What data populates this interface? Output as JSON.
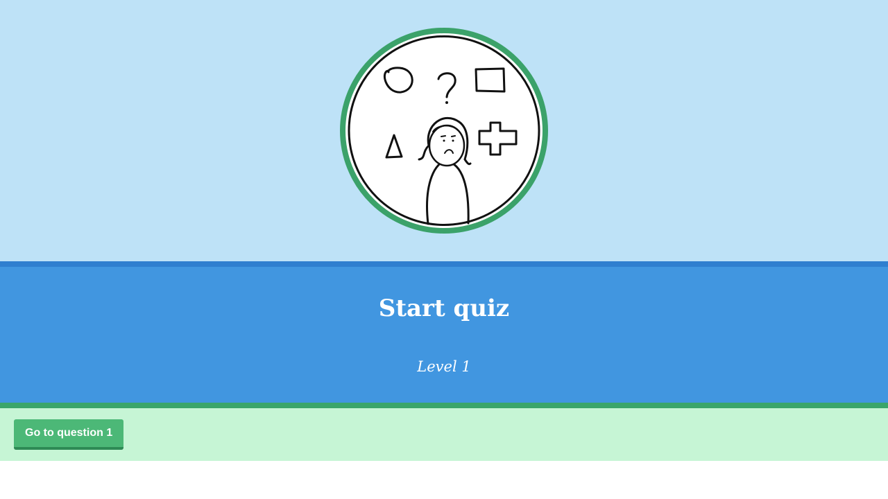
{
  "hero": {
    "image_icon": "confused-person-shapes-icon"
  },
  "quiz": {
    "title": "Start quiz",
    "subtitle": "Level 1"
  },
  "actions": {
    "start_label": "Go to question 1"
  },
  "colors": {
    "hero_bg": "#bee2f7",
    "title_band": "#4196e0",
    "title_band_border": "#2f7fcf",
    "action_bar": "#c6f5d5",
    "action_bar_border": "#3aa56a",
    "button": "#4cb877",
    "ring": "#3ba26a"
  }
}
